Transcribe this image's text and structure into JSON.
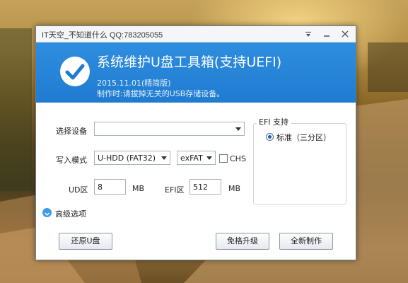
{
  "window": {
    "title": "IT天空_不知道什么 QQ:783205055"
  },
  "header": {
    "title": "系统维护U盘工具箱(支持UEFI)",
    "version": "2015.11.01(精简版)",
    "notice": "制作时:请拔掉无关的USB存储设备。"
  },
  "form": {
    "device_label": "选择设备",
    "device_value": "",
    "mode_label": "写入模式",
    "mode_value": "U-HDD (FAT32)",
    "fs_value": "exFAT",
    "chs_label": "CHS",
    "chs_checked": false,
    "ud_label": "UD区",
    "ud_value": "8",
    "ud_unit": "MB",
    "efi_label": "EFI区",
    "efi_value": "512",
    "efi_unit": "MB"
  },
  "efi_group": {
    "title": "EFI 支持",
    "option_label": "标准（三分区）",
    "option_selected": true
  },
  "advanced": {
    "label": "高级选项"
  },
  "buttons": {
    "restore": "还原U盘",
    "upgrade": "免格升级",
    "create": "全新制作"
  },
  "colors": {
    "header_bg": "#1f7bd0",
    "accent": "#3f9be6"
  }
}
